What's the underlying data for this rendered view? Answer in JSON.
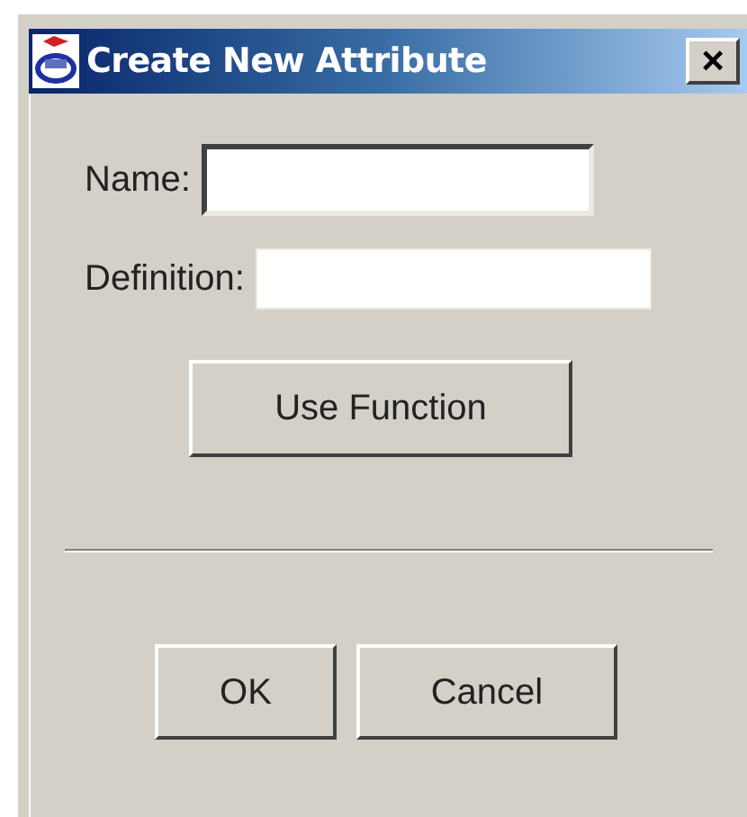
{
  "window": {
    "title": "Create New Attribute",
    "close": "×"
  },
  "fields": [
    {
      "label": "Name:",
      "focused": true
    },
    {
      "label": "Definition:",
      "focused": false
    }
  ],
  "function_button": "Use Function",
  "buttons": [
    "OK",
    "Cancel"
  ]
}
